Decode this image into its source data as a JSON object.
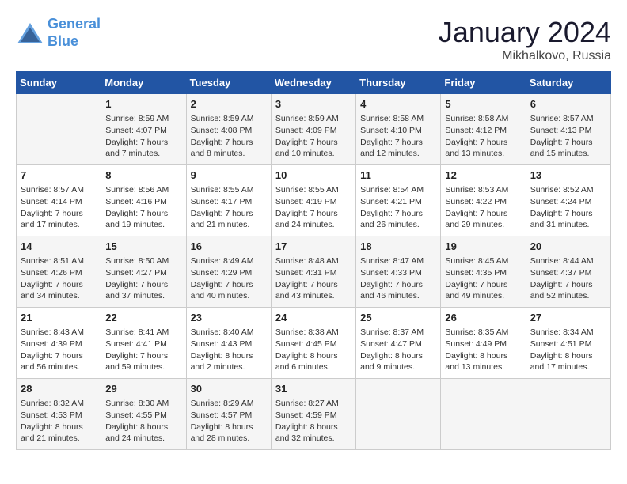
{
  "header": {
    "logo_line1": "General",
    "logo_line2": "Blue",
    "month_title": "January 2024",
    "location": "Mikhalkovo, Russia"
  },
  "weekdays": [
    "Sunday",
    "Monday",
    "Tuesday",
    "Wednesday",
    "Thursday",
    "Friday",
    "Saturday"
  ],
  "weeks": [
    [
      {
        "day": "",
        "content": ""
      },
      {
        "day": "1",
        "content": "Sunrise: 8:59 AM\nSunset: 4:07 PM\nDaylight: 7 hours\nand 7 minutes."
      },
      {
        "day": "2",
        "content": "Sunrise: 8:59 AM\nSunset: 4:08 PM\nDaylight: 7 hours\nand 8 minutes."
      },
      {
        "day": "3",
        "content": "Sunrise: 8:59 AM\nSunset: 4:09 PM\nDaylight: 7 hours\nand 10 minutes."
      },
      {
        "day": "4",
        "content": "Sunrise: 8:58 AM\nSunset: 4:10 PM\nDaylight: 7 hours\nand 12 minutes."
      },
      {
        "day": "5",
        "content": "Sunrise: 8:58 AM\nSunset: 4:12 PM\nDaylight: 7 hours\nand 13 minutes."
      },
      {
        "day": "6",
        "content": "Sunrise: 8:57 AM\nSunset: 4:13 PM\nDaylight: 7 hours\nand 15 minutes."
      }
    ],
    [
      {
        "day": "7",
        "content": "Sunrise: 8:57 AM\nSunset: 4:14 PM\nDaylight: 7 hours\nand 17 minutes."
      },
      {
        "day": "8",
        "content": "Sunrise: 8:56 AM\nSunset: 4:16 PM\nDaylight: 7 hours\nand 19 minutes."
      },
      {
        "day": "9",
        "content": "Sunrise: 8:55 AM\nSunset: 4:17 PM\nDaylight: 7 hours\nand 21 minutes."
      },
      {
        "day": "10",
        "content": "Sunrise: 8:55 AM\nSunset: 4:19 PM\nDaylight: 7 hours\nand 24 minutes."
      },
      {
        "day": "11",
        "content": "Sunrise: 8:54 AM\nSunset: 4:21 PM\nDaylight: 7 hours\nand 26 minutes."
      },
      {
        "day": "12",
        "content": "Sunrise: 8:53 AM\nSunset: 4:22 PM\nDaylight: 7 hours\nand 29 minutes."
      },
      {
        "day": "13",
        "content": "Sunrise: 8:52 AM\nSunset: 4:24 PM\nDaylight: 7 hours\nand 31 minutes."
      }
    ],
    [
      {
        "day": "14",
        "content": "Sunrise: 8:51 AM\nSunset: 4:26 PM\nDaylight: 7 hours\nand 34 minutes."
      },
      {
        "day": "15",
        "content": "Sunrise: 8:50 AM\nSunset: 4:27 PM\nDaylight: 7 hours\nand 37 minutes."
      },
      {
        "day": "16",
        "content": "Sunrise: 8:49 AM\nSunset: 4:29 PM\nDaylight: 7 hours\nand 40 minutes."
      },
      {
        "day": "17",
        "content": "Sunrise: 8:48 AM\nSunset: 4:31 PM\nDaylight: 7 hours\nand 43 minutes."
      },
      {
        "day": "18",
        "content": "Sunrise: 8:47 AM\nSunset: 4:33 PM\nDaylight: 7 hours\nand 46 minutes."
      },
      {
        "day": "19",
        "content": "Sunrise: 8:45 AM\nSunset: 4:35 PM\nDaylight: 7 hours\nand 49 minutes."
      },
      {
        "day": "20",
        "content": "Sunrise: 8:44 AM\nSunset: 4:37 PM\nDaylight: 7 hours\nand 52 minutes."
      }
    ],
    [
      {
        "day": "21",
        "content": "Sunrise: 8:43 AM\nSunset: 4:39 PM\nDaylight: 7 hours\nand 56 minutes."
      },
      {
        "day": "22",
        "content": "Sunrise: 8:41 AM\nSunset: 4:41 PM\nDaylight: 7 hours\nand 59 minutes."
      },
      {
        "day": "23",
        "content": "Sunrise: 8:40 AM\nSunset: 4:43 PM\nDaylight: 8 hours\nand 2 minutes."
      },
      {
        "day": "24",
        "content": "Sunrise: 8:38 AM\nSunset: 4:45 PM\nDaylight: 8 hours\nand 6 minutes."
      },
      {
        "day": "25",
        "content": "Sunrise: 8:37 AM\nSunset: 4:47 PM\nDaylight: 8 hours\nand 9 minutes."
      },
      {
        "day": "26",
        "content": "Sunrise: 8:35 AM\nSunset: 4:49 PM\nDaylight: 8 hours\nand 13 minutes."
      },
      {
        "day": "27",
        "content": "Sunrise: 8:34 AM\nSunset: 4:51 PM\nDaylight: 8 hours\nand 17 minutes."
      }
    ],
    [
      {
        "day": "28",
        "content": "Sunrise: 8:32 AM\nSunset: 4:53 PM\nDaylight: 8 hours\nand 21 minutes."
      },
      {
        "day": "29",
        "content": "Sunrise: 8:30 AM\nSunset: 4:55 PM\nDaylight: 8 hours\nand 24 minutes."
      },
      {
        "day": "30",
        "content": "Sunrise: 8:29 AM\nSunset: 4:57 PM\nDaylight: 8 hours\nand 28 minutes."
      },
      {
        "day": "31",
        "content": "Sunrise: 8:27 AM\nSunset: 4:59 PM\nDaylight: 8 hours\nand 32 minutes."
      },
      {
        "day": "",
        "content": ""
      },
      {
        "day": "",
        "content": ""
      },
      {
        "day": "",
        "content": ""
      }
    ]
  ]
}
